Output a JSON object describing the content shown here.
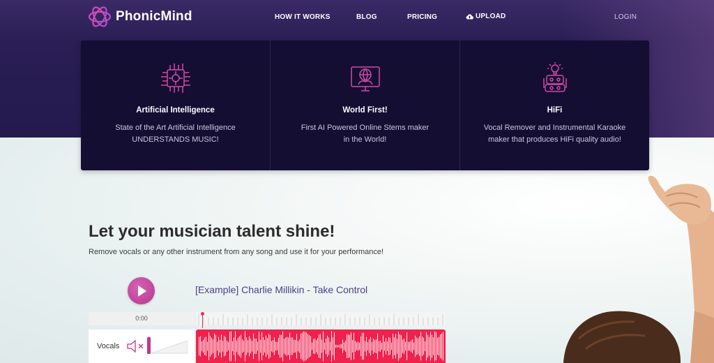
{
  "brand": {
    "name": "PhonicMind"
  },
  "nav": {
    "how_it_works": "HOW IT WORKS",
    "blog": "BLOG",
    "pricing": "PRICING",
    "upload": "UPLOAD",
    "login": "LOGIN"
  },
  "features": [
    {
      "icon": "circuit-chip-icon",
      "title": "Artificial Intelligence",
      "desc_line1": "State of the Art Artificial Intelligence",
      "desc_line2": "UNDERSTANDS MUSIC!"
    },
    {
      "icon": "globe-monitor-icon",
      "title": "World First!",
      "desc_line1": "First AI Powered Online Stems maker",
      "desc_line2": "in the World!"
    },
    {
      "icon": "robot-lightbulb-icon",
      "title": "HiFi",
      "desc_line1": "Vocal Remover and Instrumental Karaoke",
      "desc_line2": "maker that produces HiFi quality audio!"
    }
  ],
  "main": {
    "headline": "Let your musician talent shine!",
    "subline": "Remove vocals or any other instrument from any song and use it for your performance!"
  },
  "player": {
    "track_title": "[Example] Charlie Millikin - Take Control",
    "time": "0:00",
    "stems": [
      {
        "name": "Vocals"
      }
    ]
  },
  "colors": {
    "accent_pink": "#c2348c",
    "wave_red": "#f0224d",
    "card_bg": "#150e33",
    "title_purple": "#4a3f86"
  }
}
